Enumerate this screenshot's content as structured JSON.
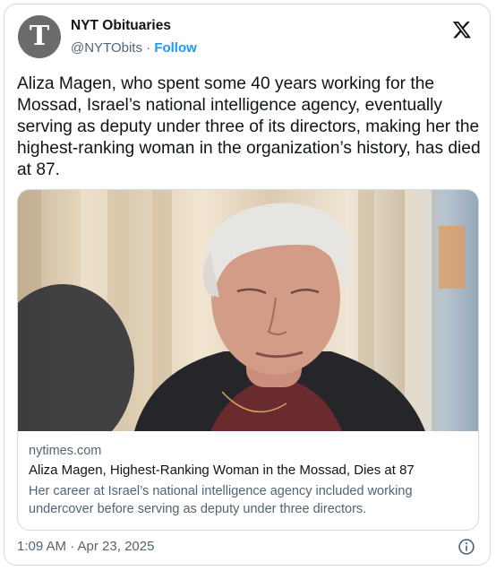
{
  "account": {
    "name": "NYT Obituaries",
    "handle": "@NYTObits",
    "separator": "·",
    "follow_label": "Follow",
    "avatar_glyph": "T"
  },
  "tweet": {
    "text": "Aliza Magen, who spent some 40 years working for the Mossad, Israel’s national intelligence agency, eventually serving as deputy under three of its directors, making her the highest-ranking woman in the organization’s history, has died at 87."
  },
  "link_card": {
    "domain": "nytimes.com",
    "headline": "Aliza Magen, Highest-Ranking Woman in the Mossad, Dies at 87",
    "description": "Her career at Israel’s national intelligence agency included working undercover before serving as deputy under three directors."
  },
  "timestamp": "1:09 AM · Apr 23, 2025",
  "icons": {
    "logo": "x-logo-icon",
    "info": "info-icon"
  },
  "colors": {
    "accent": "#1d9bf0",
    "text": "#0f1419",
    "muted": "#536471",
    "border": "#cfd9de"
  }
}
